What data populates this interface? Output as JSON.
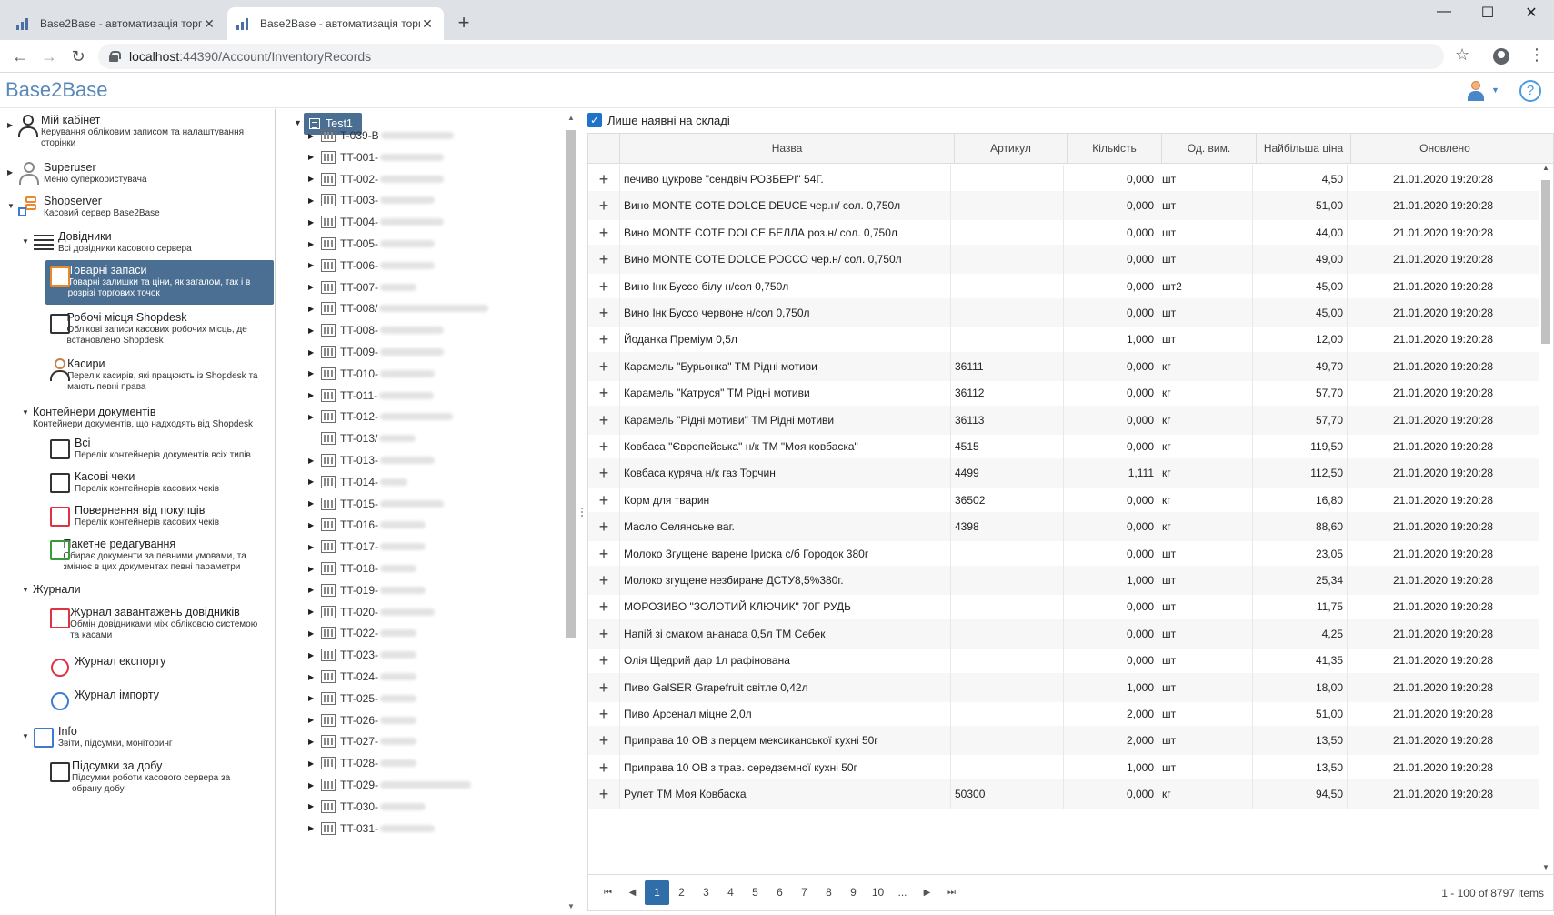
{
  "browser": {
    "tabs": [
      {
        "title": "Base2Base - автоматизація торг"
      },
      {
        "title": "Base2Base - автоматизація торг"
      }
    ],
    "new_tab": "+",
    "window": {
      "minimize": "—",
      "maximize": "☐",
      "close": "✕"
    },
    "nav": {
      "back": "←",
      "forward": "→",
      "reload": "↻"
    },
    "url_host": "localhost",
    "url_path": ":44390/Account/InventoryRecords",
    "star": "☆",
    "menu": "⋮"
  },
  "app": {
    "logo": "Base2Base",
    "help": "?",
    "user_caret": "▼"
  },
  "leftnav": {
    "items": [
      {
        "title": "Мій кабінет",
        "desc": "Керування обліковим записом та налаштування сторінки"
      },
      {
        "title": "Superuser",
        "desc": "Меню суперкористувача"
      },
      {
        "title": "Shopserver",
        "desc": "Касовий сервер Base2Base"
      },
      {
        "title": "Довідники",
        "desc": "Всі довідники касового сервера"
      },
      {
        "title": "Товарні запаси",
        "desc": "Товарні залишки та ціни, як загалом, так і в розрізі торгових точок"
      },
      {
        "title": "Робочі місця Shopdesk",
        "desc": "Облікові записи касових робочих місць, де встановлено Shopdesk"
      },
      {
        "title": "Касири",
        "desc": "Перелік касирів, які працюють із Shopdesk та мають певні права"
      },
      {
        "title": "Контейнери документів",
        "desc": "Контейнери документів, що надходять від Shopdesk"
      },
      {
        "title": "Всі",
        "desc": "Перелік контейнерів документів всіх типів"
      },
      {
        "title": "Касові чеки",
        "desc": "Перелік контейнерів касових чеків"
      },
      {
        "title": "Повернення від покупців",
        "desc": "Перелік контейнерів касових чеків"
      },
      {
        "title": "Пакетне редагування",
        "desc": "Обирає документи за певними умовами, та змінює в цих документах певні параметри"
      },
      {
        "title": "Журнали",
        "desc": ""
      },
      {
        "title": "Журнал завантажень довідників",
        "desc": "Обмін довідниками між обліковою системою та касами"
      },
      {
        "title": "Журнал експорту",
        "desc": ""
      },
      {
        "title": "Журнал імпорту",
        "desc": ""
      },
      {
        "title": "Info",
        "desc": "Звіти, підсумки, моніторинг"
      },
      {
        "title": "Підсумки за добу",
        "desc": "Підсумки роботи касового сервера за обрану добу"
      }
    ]
  },
  "tree": {
    "root": "Test1",
    "nodes": [
      "T-039-В",
      "TT-001-",
      "TT-002-",
      "TT-003-",
      "TT-004-",
      "TT-005-",
      "TT-006-",
      "TT-007-",
      "TT-008/",
      "TT-008-",
      "TT-009-",
      "TT-010-",
      "TT-011-",
      "TT-012-",
      "TT-013/",
      "TT-013-",
      "TT-014-",
      "TT-015-",
      "TT-016-",
      "TT-017-",
      "TT-018-",
      "TT-019-",
      "TT-020-",
      "TT-022-",
      "TT-023-",
      "TT-024-",
      "TT-025-",
      "TT-026-",
      "TT-027-",
      "TT-028-",
      "TT-029-",
      "TT-030-",
      "TT-031-"
    ]
  },
  "grid": {
    "only_in_stock_label": "Лише наявні на складі",
    "columns": [
      "Назва",
      "Артикул",
      "Кількість",
      "Од. вим.",
      "Найбільша ціна",
      "Оновлено"
    ],
    "rows": [
      [
        "печиво цукрове \"сендвіч РОЗБЕРІ\" 54Г.",
        "",
        "0,000",
        "шт",
        "4,50",
        "21.01.2020 19:20:28"
      ],
      [
        "Вино MONTE COTE DOLCE DEUCE чер.н/ сол. 0,750л",
        "",
        "0,000",
        "шт",
        "51,00",
        "21.01.2020 19:20:28"
      ],
      [
        "Вино MONTE COTE DOLCE БЕЛЛА роз.н/ сол. 0,750л",
        "",
        "0,000",
        "шт",
        "44,00",
        "21.01.2020 19:20:28"
      ],
      [
        "Вино MONTE COTE DOLCE РОССО чер.н/ сол. 0,750л",
        "",
        "0,000",
        "шт",
        "49,00",
        "21.01.2020 19:20:28"
      ],
      [
        "Вино Інк Буссо білу н/сол 0,750л",
        "",
        "0,000",
        "шт2",
        "45,00",
        "21.01.2020 19:20:28"
      ],
      [
        "Вино Інк Буссо червоне н/сол 0,750л",
        "",
        "0,000",
        "шт",
        "45,00",
        "21.01.2020 19:20:28"
      ],
      [
        "Йоданка Преміум 0,5л",
        "",
        "1,000",
        "шт",
        "12,00",
        "21.01.2020 19:20:28"
      ],
      [
        "Карамель \"Бурьонка\" ТМ Рідні мотиви",
        "36111",
        "0,000",
        "кг",
        "49,70",
        "21.01.2020 19:20:28"
      ],
      [
        "Карамель \"Катруся\" ТМ Рідні мотиви",
        "36112",
        "0,000",
        "кг",
        "57,70",
        "21.01.2020 19:20:28"
      ],
      [
        "Карамель \"Рідні мотиви\" ТМ Рідні мотиви",
        "36113",
        "0,000",
        "кг",
        "57,70",
        "21.01.2020 19:20:28"
      ],
      [
        "Ковбаса \"Європейська\" н/к ТМ \"Моя ковбаска\"",
        "4515",
        "0,000",
        "кг",
        "119,50",
        "21.01.2020 19:20:28"
      ],
      [
        "Ковбаса куряча н/к газ Торчин",
        "4499",
        "1,111",
        "кг",
        "112,50",
        "21.01.2020 19:20:28"
      ],
      [
        "Корм для тварин",
        "36502",
        "0,000",
        "кг",
        "16,80",
        "21.01.2020 19:20:28"
      ],
      [
        "Масло Селянське ваг.",
        "4398",
        "0,000",
        "кг",
        "88,60",
        "21.01.2020 19:20:28"
      ],
      [
        "Молоко Згущене варене Іриска с/б Городок 380г",
        "",
        "0,000",
        "шт",
        "23,05",
        "21.01.2020 19:20:28"
      ],
      [
        "Молоко згущене незбиране ДСТУ8,5%380г.",
        "",
        "1,000",
        "шт",
        "25,34",
        "21.01.2020 19:20:28"
      ],
      [
        "МОРОЗИВО \"ЗОЛОТИЙ КЛЮЧИК\" 70Г РУДЬ",
        "",
        "0,000",
        "шт",
        "11,75",
        "21.01.2020 19:20:28"
      ],
      [
        "Напій зі смаком ананаса 0,5л ТМ Себек",
        "",
        "0,000",
        "шт",
        "4,25",
        "21.01.2020 19:20:28"
      ],
      [
        "Олія Щедрий дар 1л рафінована",
        "",
        "0,000",
        "шт",
        "41,35",
        "21.01.2020 19:20:28"
      ],
      [
        "Пиво GalSER Grapefruit світле 0,42л",
        "",
        "1,000",
        "шт",
        "18,00",
        "21.01.2020 19:20:28"
      ],
      [
        "Пиво Арсенал міцне 2,0л",
        "",
        "2,000",
        "шт",
        "51,00",
        "21.01.2020 19:20:28"
      ],
      [
        "Приправа 10 ОВ з перцем мексиканської кухні 50г",
        "",
        "2,000",
        "шт",
        "13,50",
        "21.01.2020 19:20:28"
      ],
      [
        "Приправа 10 ОВ з трав. середземної кухні 50г",
        "",
        "1,000",
        "шт",
        "13,50",
        "21.01.2020 19:20:28"
      ],
      [
        "Рулет ТМ Моя Ковбаска",
        "50300",
        "0,000",
        "кг",
        "94,50",
        "21.01.2020 19:20:28"
      ]
    ]
  },
  "pager": {
    "first": "⏮",
    "prev": "◀",
    "next": "▶",
    "last": "⏭",
    "pages": [
      "1",
      "2",
      "3",
      "4",
      "5",
      "6",
      "7",
      "8",
      "9",
      "10",
      "..."
    ],
    "current": "1",
    "info": "1 - 100 of 8797 items"
  }
}
